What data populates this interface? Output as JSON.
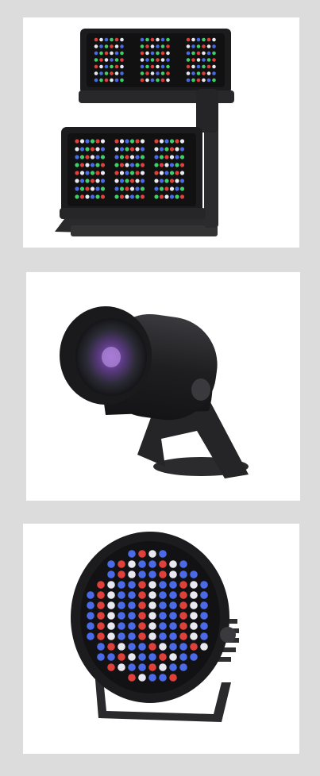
{
  "products": [
    {
      "name": "dual-panel-rgb-floodlight"
    },
    {
      "name": "cylindrical-spotlight"
    },
    {
      "name": "round-rgb-wash-light"
    }
  ],
  "colors": {
    "background": "#dcdcdc",
    "card": "#ffffff",
    "housing": "#1f1f21",
    "led_red": "#e0403a",
    "led_green": "#3fcf6a",
    "led_blue": "#4a6ae8",
    "led_white": "#e8e8f0"
  }
}
